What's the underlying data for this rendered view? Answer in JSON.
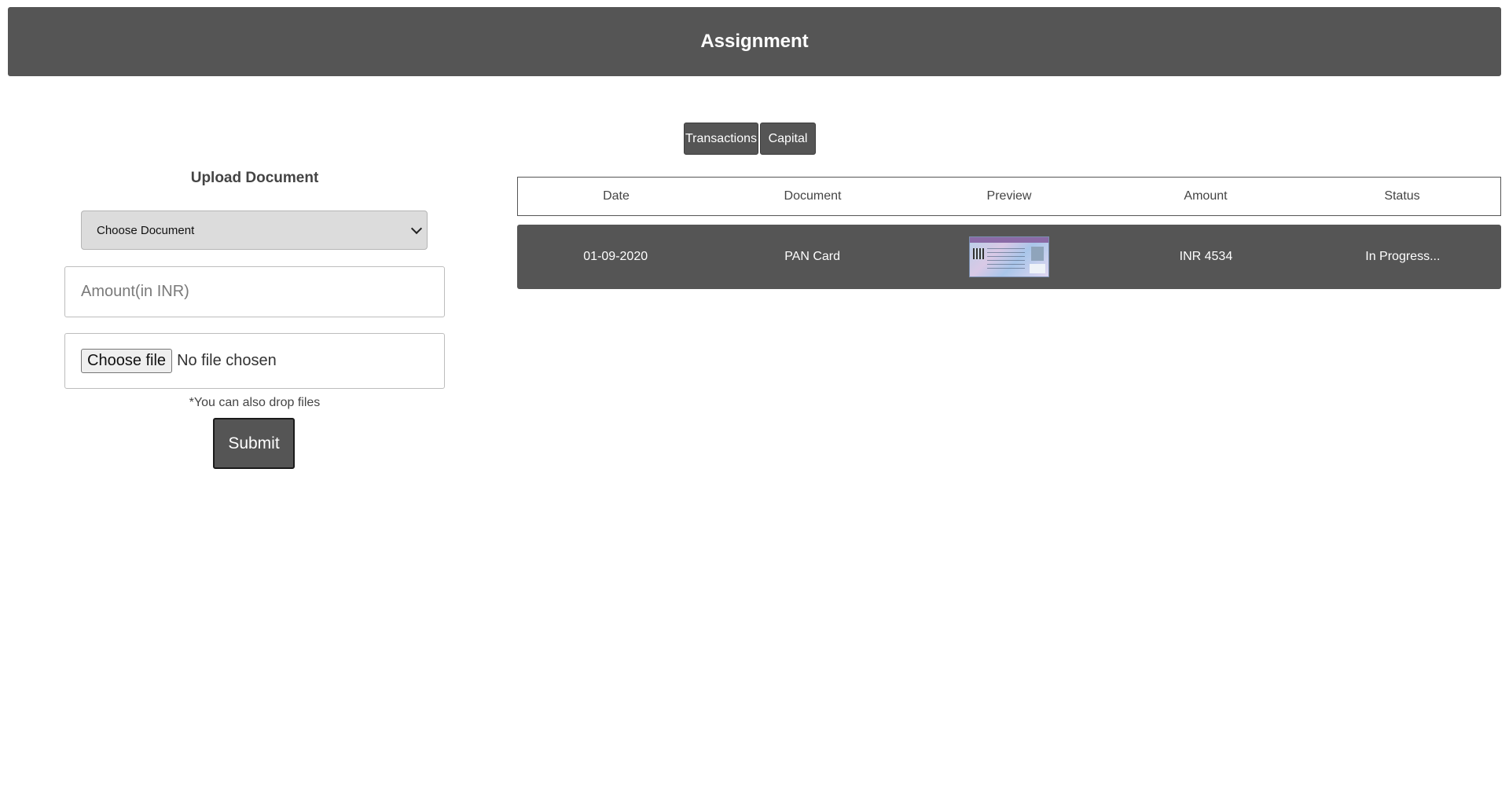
{
  "header": {
    "title": "Assignment"
  },
  "tabs": [
    {
      "label": "Transactions"
    },
    {
      "label": "Capital"
    }
  ],
  "upload": {
    "title": "Upload Document",
    "select_value": "Choose Document",
    "amount_placeholder": "Amount(in INR)",
    "file_button_label": "Choose file",
    "file_status": "No file chosen",
    "drop_hint": "*You can also drop files",
    "submit_label": "Submit"
  },
  "table": {
    "columns": [
      "Date",
      "Document",
      "Preview",
      "Amount",
      "Status"
    ],
    "rows": [
      {
        "date": "01-09-2020",
        "document": "PAN Card",
        "amount": "INR 4534",
        "status": "In Progress..."
      }
    ]
  },
  "colors": {
    "header_bg": "#555555",
    "button_bg": "#555555",
    "row_bg": "#555555"
  }
}
